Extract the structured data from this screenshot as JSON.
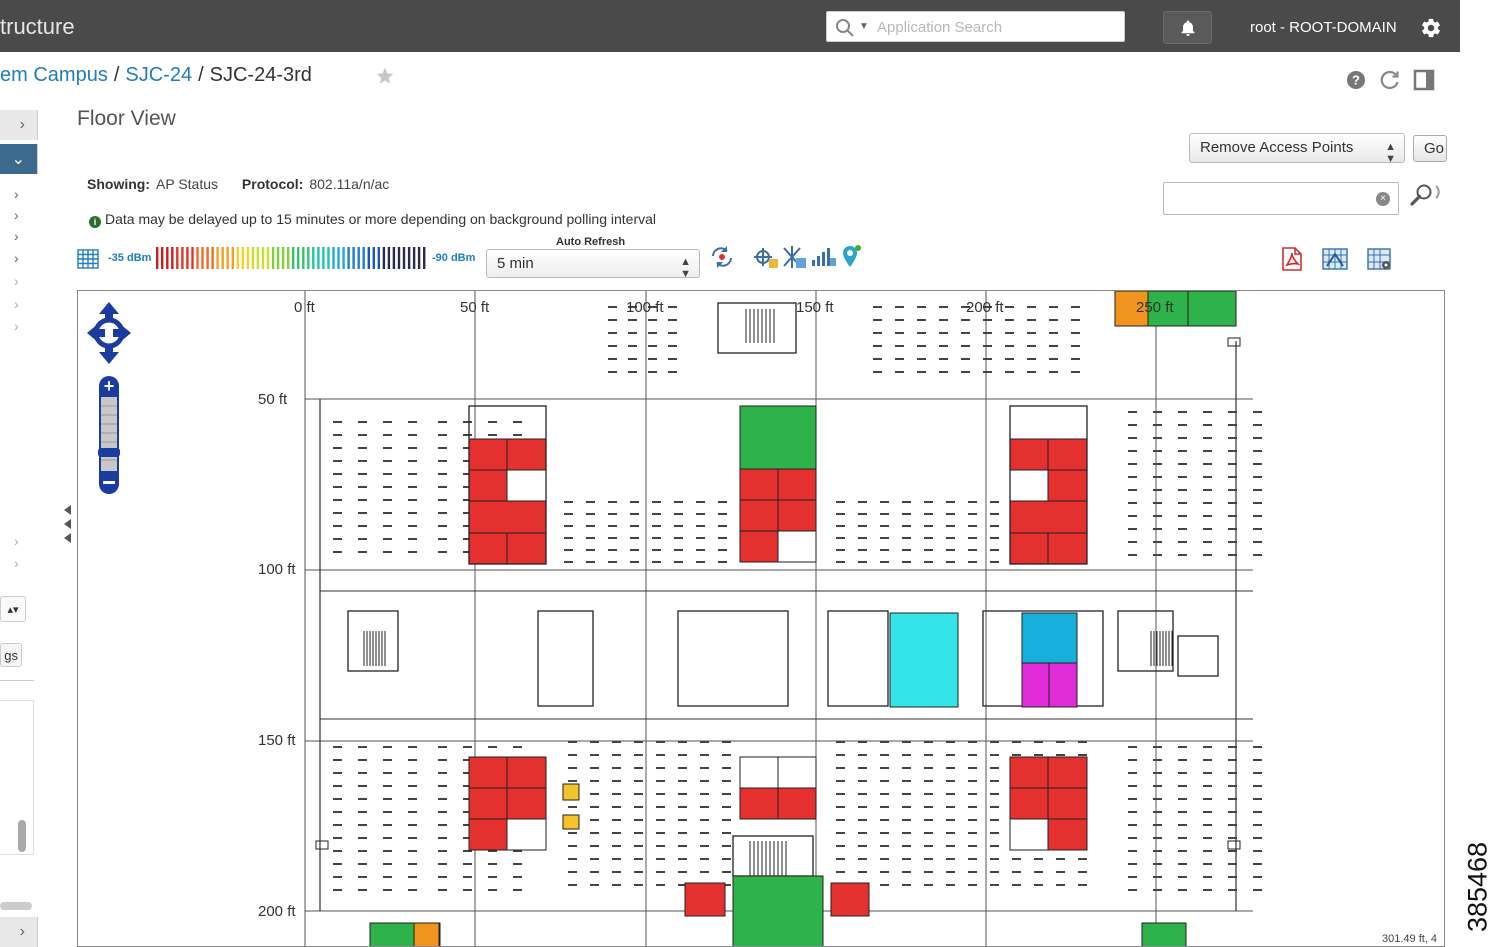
{
  "topbar": {
    "section_title": "tructure",
    "search_placeholder": "Application Search",
    "user": "root - ROOT-DOMAIN"
  },
  "breadcrumb": {
    "crumbs": [
      "em Campus",
      "SJC-24"
    ],
    "separator": "/",
    "current": "SJC-24-3rd"
  },
  "sidebar": {
    "select_label": "▴▾",
    "button_label": "gs"
  },
  "panel": {
    "title": "Floor View",
    "showing_label": "Showing:",
    "showing_value": "AP Status",
    "protocol_label": "Protocol:",
    "protocol_value": "802.11a/n/ac",
    "notice": "Data may be delayed up to 15 minutes or more depending on background polling interval"
  },
  "legend": {
    "dbm_high": "-35 dBm",
    "dbm_low": "-90 dBm"
  },
  "auto_refresh": {
    "label": "Auto Refresh",
    "value": "5 min"
  },
  "actions": {
    "remove_select": "Remove Access Points",
    "go_label": "Go"
  },
  "map": {
    "x_ruler": [
      "0 ft",
      "50 ft",
      "100 ft",
      "150 ft",
      "200 ft",
      "250 ft"
    ],
    "y_ruler": [
      "50 ft",
      "100 ft",
      "150 ft",
      "200 ft"
    ],
    "coord_readout": "301.49 ft, 4",
    "room_colors": {
      "red": "#e53030",
      "green": "#2db34a",
      "cyan": "#33e5e8",
      "blue": "#17b0dd",
      "magenta": "#e02bd8",
      "orange": "#f0941e",
      "yellow": "#f2c42a"
    }
  },
  "figure_id": "385468",
  "colors": {
    "topbar": "#4a4a4a",
    "link": "#1f7fb8",
    "nav_control": "#1a3c9e"
  }
}
